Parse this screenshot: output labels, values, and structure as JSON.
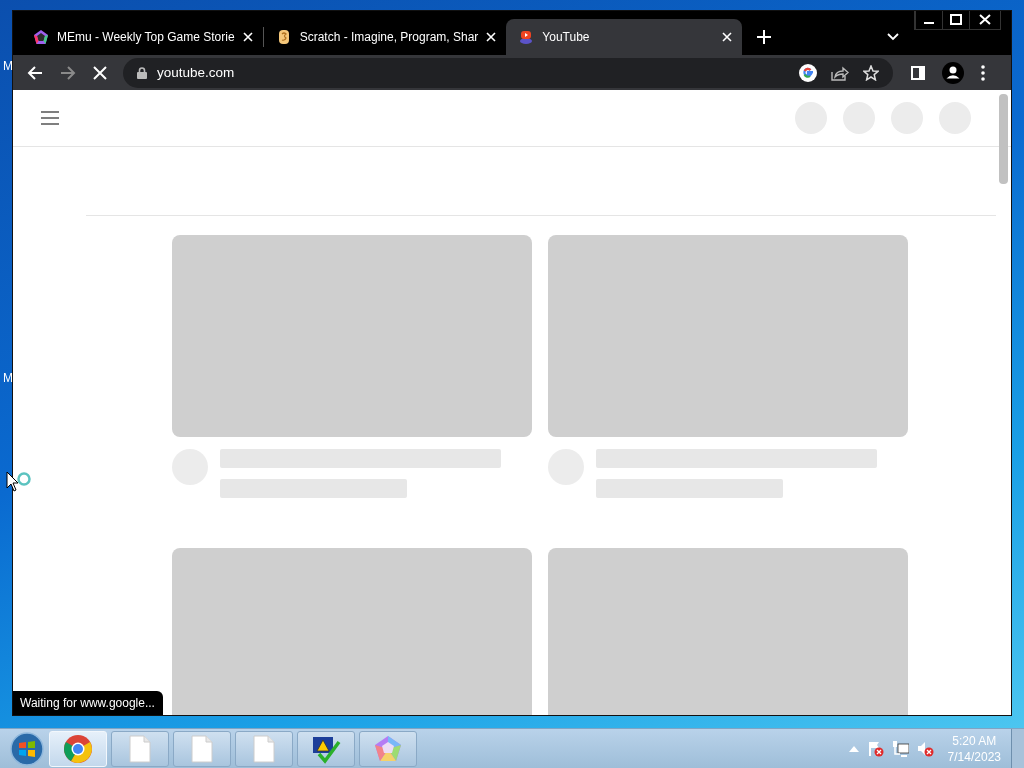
{
  "desktop": {
    "icon_labels": [
      "M",
      "M"
    ]
  },
  "browser": {
    "tabs": [
      {
        "title": "MEmu - Weekly Top Game Storie",
        "kind": "memu",
        "selected": false
      },
      {
        "title": "Scratch - Imagine, Program, Shar",
        "kind": "scratch",
        "selected": false
      },
      {
        "title": "YouTube",
        "kind": "youtube",
        "selected": true
      }
    ],
    "address": "youtube.com",
    "loading": true,
    "status_bubble": "Waiting for www.google..."
  },
  "taskbar": {
    "buttons": [
      {
        "kind": "chrome",
        "selected": true
      },
      {
        "kind": "file",
        "selected": false
      },
      {
        "kind": "file",
        "selected": false
      },
      {
        "kind": "file",
        "selected": false
      },
      {
        "kind": "action-center",
        "selected": false
      },
      {
        "kind": "memu",
        "selected": false
      }
    ],
    "tray": [
      {
        "kind": "flag-error"
      },
      {
        "kind": "network"
      },
      {
        "kind": "volume-muted"
      }
    ],
    "time": "5:20 AM",
    "date": "7/14/2023"
  }
}
